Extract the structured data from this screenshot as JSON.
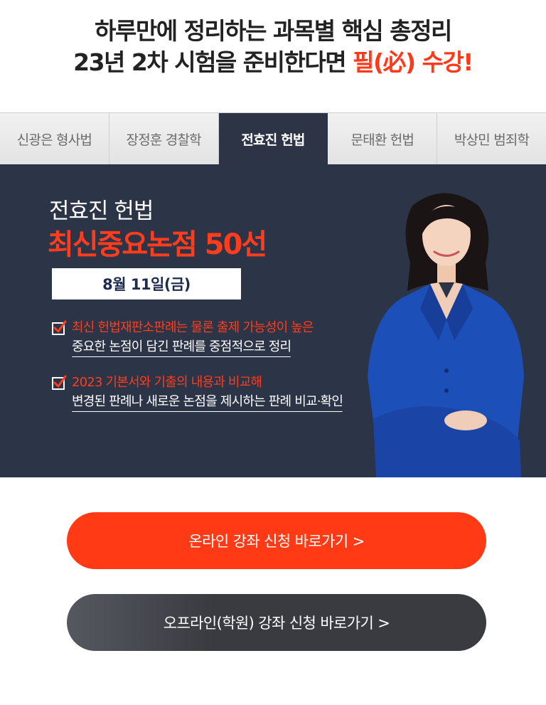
{
  "headline": {
    "line1": "하루만에 정리하는 과목별 핵심 총정리",
    "line2_prefix": "23년 2차 시험을 준비한다면 ",
    "line2_highlight": "필(必) 수강!"
  },
  "tabs": [
    {
      "label": "신광은 형사법",
      "active": false
    },
    {
      "label": "장정훈 경찰학",
      "active": false
    },
    {
      "label": "전효진 헌법",
      "active": true
    },
    {
      "label": "문태환 헌법",
      "active": false
    },
    {
      "label": "박상민 범죄학",
      "active": false
    }
  ],
  "banner": {
    "subtitle": "전효진 헌법",
    "title": "최신중요논점 50선",
    "date": "8월 11일(금)",
    "points": [
      {
        "line1": "최신 헌법재판소판례는 물론 출제 가능성이 높은",
        "line2": "중요한 논점이 담긴 판례를 중점적으로 정리"
      },
      {
        "line1": "2023 기본서와 기출의 내용과 비교해",
        "line2": "변경된 판례나 새로운 논점을 제시하는 판례 비교·확인"
      }
    ]
  },
  "buttons": {
    "online": "온라인 강좌 신청 바로가기 >",
    "offline": "오프라인(학원) 강좌 신청 바로가기 >"
  },
  "colors": {
    "accent": "#ff3a14",
    "banner_bg": "#2c3447",
    "dark_button": "#393b41"
  }
}
